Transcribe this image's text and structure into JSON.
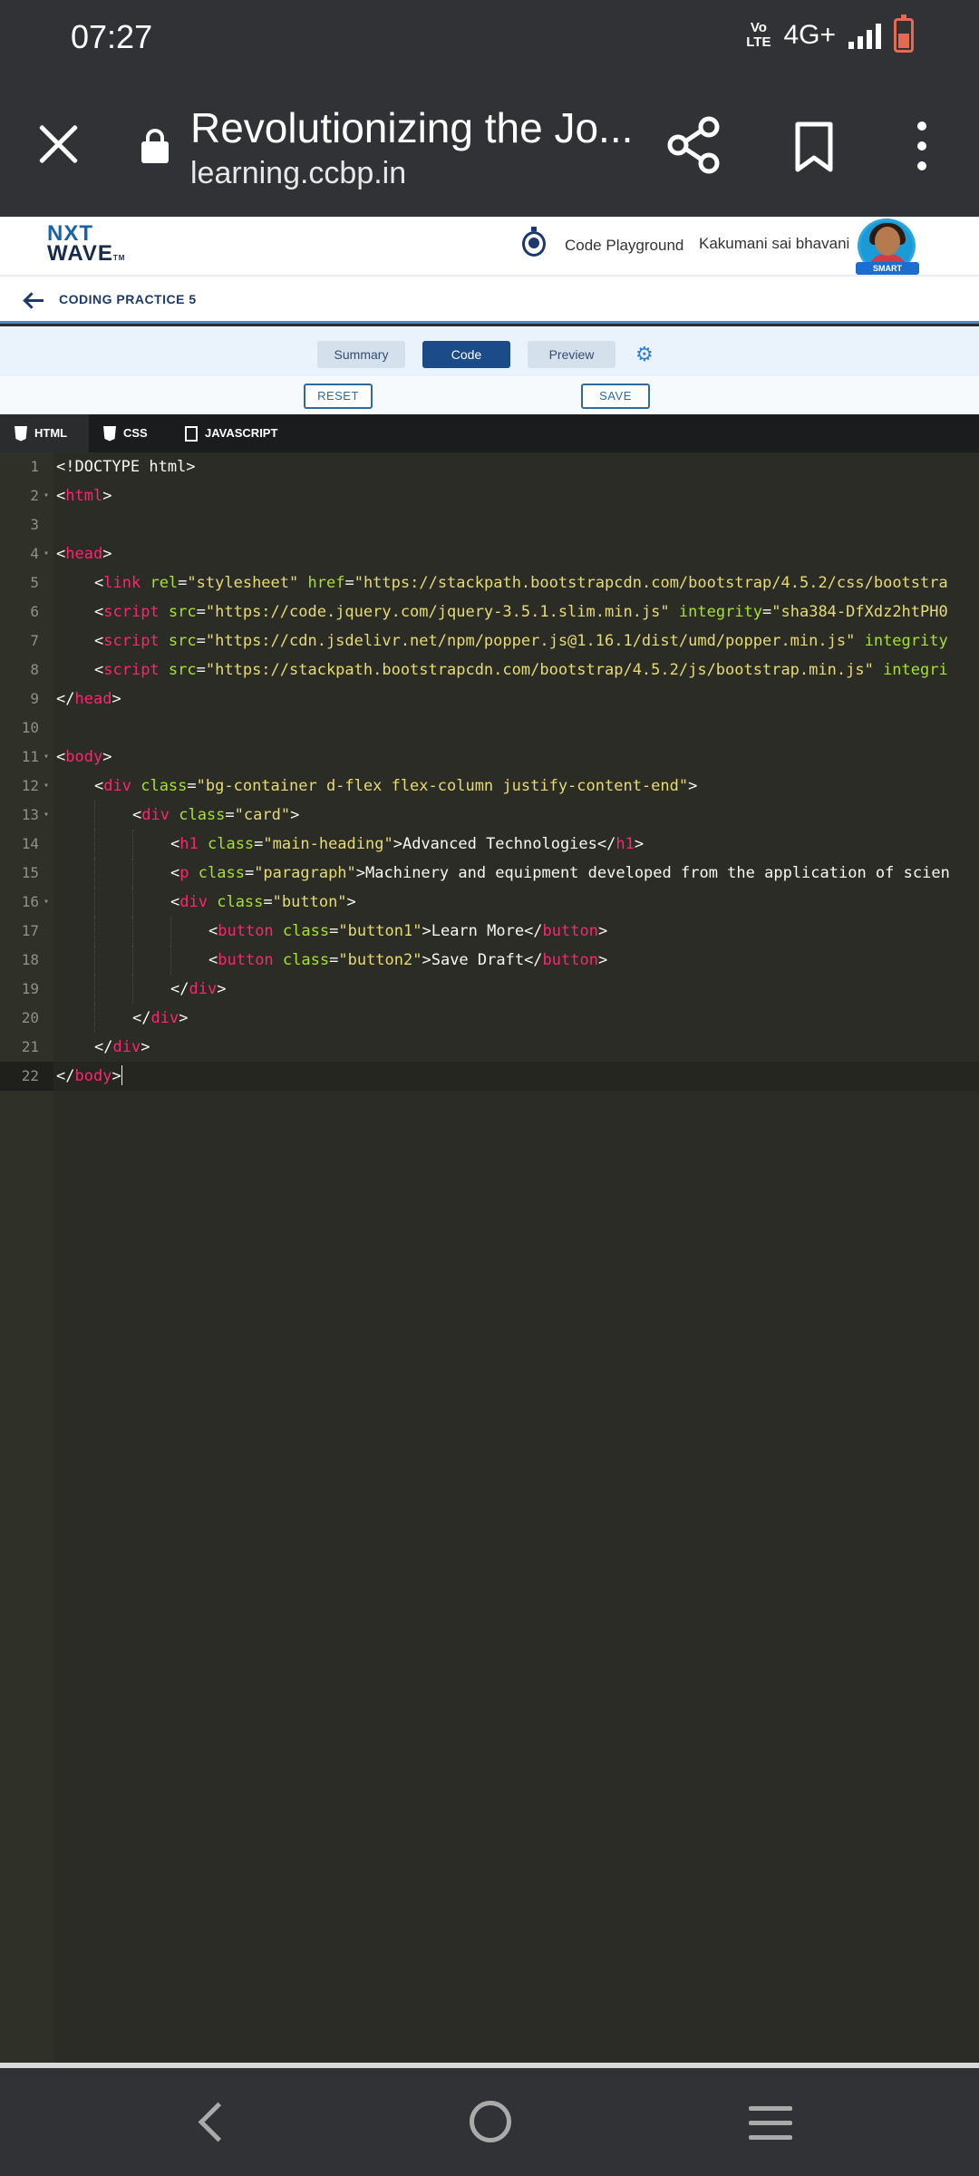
{
  "status_bar": {
    "time": "07:27",
    "volte_top": "Vo",
    "volte_bottom": "LTE",
    "network": "4G+"
  },
  "browser": {
    "title": "Revolutionizing the Jo...",
    "url": "learning.ccbp.in"
  },
  "site_header": {
    "logo_line1": "NXT",
    "logo_line2": "WAVE",
    "logo_tm": "TM",
    "playground_label": "Code Playground",
    "user_name": "Kakumani sai bhavani",
    "avatar_badge": "SMART"
  },
  "practice": {
    "title": "CODING PRACTICE 5"
  },
  "tabs": {
    "summary": "Summary",
    "code": "Code",
    "preview": "Preview"
  },
  "actions": {
    "reset": "RESET",
    "save": "SAVE"
  },
  "editor_tabs": {
    "html": "HTML",
    "css": "CSS",
    "js": "JAVASCRIPT"
  },
  "colors": {
    "tag": "#f92672",
    "attr": "#a6e22e",
    "string": "#e6db74",
    "text": "#f8f8f2",
    "accent": "#1b4b89"
  },
  "code_lines": [
    {
      "n": "1",
      "fold": false,
      "indent": 0,
      "tokens": [
        {
          "t": "<!DOCTYPE html>",
          "c": "text"
        }
      ]
    },
    {
      "n": "2",
      "fold": true,
      "indent": 0,
      "tokens": [
        {
          "t": "<",
          "c": "text"
        },
        {
          "t": "html",
          "c": "tag"
        },
        {
          "t": ">",
          "c": "text"
        }
      ]
    },
    {
      "n": "3",
      "fold": false,
      "indent": 0,
      "tokens": []
    },
    {
      "n": "4",
      "fold": true,
      "indent": 0,
      "tokens": [
        {
          "t": "<",
          "c": "text"
        },
        {
          "t": "head",
          "c": "tag"
        },
        {
          "t": ">",
          "c": "text"
        }
      ]
    },
    {
      "n": "5",
      "fold": false,
      "indent": 1,
      "tokens": [
        {
          "t": "<",
          "c": "text"
        },
        {
          "t": "link",
          "c": "tag"
        },
        {
          "t": " ",
          "c": "text"
        },
        {
          "t": "rel",
          "c": "attr"
        },
        {
          "t": "=",
          "c": "text"
        },
        {
          "t": "\"stylesheet\"",
          "c": "string"
        },
        {
          "t": " ",
          "c": "text"
        },
        {
          "t": "href",
          "c": "attr"
        },
        {
          "t": "=",
          "c": "text"
        },
        {
          "t": "\"https://stackpath.bootstrapcdn.com/bootstrap/4.5.2/css/bootstra",
          "c": "string"
        }
      ]
    },
    {
      "n": "6",
      "fold": false,
      "indent": 1,
      "tokens": [
        {
          "t": "<",
          "c": "text"
        },
        {
          "t": "script",
          "c": "tag"
        },
        {
          "t": " ",
          "c": "text"
        },
        {
          "t": "src",
          "c": "attr"
        },
        {
          "t": "=",
          "c": "text"
        },
        {
          "t": "\"https://code.jquery.com/jquery-3.5.1.slim.min.js\"",
          "c": "string"
        },
        {
          "t": " ",
          "c": "text"
        },
        {
          "t": "integrity",
          "c": "attr"
        },
        {
          "t": "=",
          "c": "text"
        },
        {
          "t": "\"sha384-DfXdz2htPH0",
          "c": "string"
        }
      ]
    },
    {
      "n": "7",
      "fold": false,
      "indent": 1,
      "tokens": [
        {
          "t": "<",
          "c": "text"
        },
        {
          "t": "script",
          "c": "tag"
        },
        {
          "t": " ",
          "c": "text"
        },
        {
          "t": "src",
          "c": "attr"
        },
        {
          "t": "=",
          "c": "text"
        },
        {
          "t": "\"https://cdn.jsdelivr.net/npm/popper.js@1.16.1/dist/umd/popper.min.js\"",
          "c": "string"
        },
        {
          "t": " ",
          "c": "text"
        },
        {
          "t": "integrity",
          "c": "attr"
        }
      ]
    },
    {
      "n": "8",
      "fold": false,
      "indent": 1,
      "tokens": [
        {
          "t": "<",
          "c": "text"
        },
        {
          "t": "script",
          "c": "tag"
        },
        {
          "t": " ",
          "c": "text"
        },
        {
          "t": "src",
          "c": "attr"
        },
        {
          "t": "=",
          "c": "text"
        },
        {
          "t": "\"https://stackpath.bootstrapcdn.com/bootstrap/4.5.2/js/bootstrap.min.js\"",
          "c": "string"
        },
        {
          "t": " ",
          "c": "text"
        },
        {
          "t": "integri",
          "c": "attr"
        }
      ]
    },
    {
      "n": "9",
      "fold": false,
      "indent": 0,
      "tokens": [
        {
          "t": "</",
          "c": "text"
        },
        {
          "t": "head",
          "c": "tag"
        },
        {
          "t": ">",
          "c": "text"
        }
      ]
    },
    {
      "n": "10",
      "fold": false,
      "indent": 0,
      "tokens": []
    },
    {
      "n": "11",
      "fold": true,
      "indent": 0,
      "tokens": [
        {
          "t": "<",
          "c": "text"
        },
        {
          "t": "body",
          "c": "tag"
        },
        {
          "t": ">",
          "c": "text"
        }
      ]
    },
    {
      "n": "12",
      "fold": true,
      "indent": 1,
      "tokens": [
        {
          "t": "<",
          "c": "text"
        },
        {
          "t": "div",
          "c": "tag"
        },
        {
          "t": " ",
          "c": "text"
        },
        {
          "t": "class",
          "c": "attr"
        },
        {
          "t": "=",
          "c": "text"
        },
        {
          "t": "\"bg-container d-flex flex-column justify-content-end\"",
          "c": "string"
        },
        {
          "t": ">",
          "c": "text"
        }
      ]
    },
    {
      "n": "13",
      "fold": true,
      "indent": 2,
      "tokens": [
        {
          "t": "<",
          "c": "text"
        },
        {
          "t": "div",
          "c": "tag"
        },
        {
          "t": " ",
          "c": "text"
        },
        {
          "t": "class",
          "c": "attr"
        },
        {
          "t": "=",
          "c": "text"
        },
        {
          "t": "\"card\"",
          "c": "string"
        },
        {
          "t": ">",
          "c": "text"
        }
      ]
    },
    {
      "n": "14",
      "fold": false,
      "indent": 3,
      "tokens": [
        {
          "t": "<",
          "c": "text"
        },
        {
          "t": "h1",
          "c": "tag"
        },
        {
          "t": " ",
          "c": "text"
        },
        {
          "t": "class",
          "c": "attr"
        },
        {
          "t": "=",
          "c": "text"
        },
        {
          "t": "\"main-heading\"",
          "c": "string"
        },
        {
          "t": ">Advanced Technologies</",
          "c": "text"
        },
        {
          "t": "h1",
          "c": "tag"
        },
        {
          "t": ">",
          "c": "text"
        }
      ]
    },
    {
      "n": "15",
      "fold": false,
      "indent": 3,
      "tokens": [
        {
          "t": "<",
          "c": "text"
        },
        {
          "t": "p",
          "c": "tag"
        },
        {
          "t": " ",
          "c": "text"
        },
        {
          "t": "class",
          "c": "attr"
        },
        {
          "t": "=",
          "c": "text"
        },
        {
          "t": "\"paragraph\"",
          "c": "string"
        },
        {
          "t": ">Machinery and equipment developed from the application of scien",
          "c": "text"
        }
      ]
    },
    {
      "n": "16",
      "fold": true,
      "indent": 3,
      "tokens": [
        {
          "t": "<",
          "c": "text"
        },
        {
          "t": "div",
          "c": "tag"
        },
        {
          "t": " ",
          "c": "text"
        },
        {
          "t": "class",
          "c": "attr"
        },
        {
          "t": "=",
          "c": "text"
        },
        {
          "t": "\"button\"",
          "c": "string"
        },
        {
          "t": ">",
          "c": "text"
        }
      ]
    },
    {
      "n": "17",
      "fold": false,
      "indent": 4,
      "tokens": [
        {
          "t": "<",
          "c": "text"
        },
        {
          "t": "button",
          "c": "tag"
        },
        {
          "t": " ",
          "c": "text"
        },
        {
          "t": "class",
          "c": "attr"
        },
        {
          "t": "=",
          "c": "text"
        },
        {
          "t": "\"button1\"",
          "c": "string"
        },
        {
          "t": ">Learn More</",
          "c": "text"
        },
        {
          "t": "button",
          "c": "tag"
        },
        {
          "t": ">",
          "c": "text"
        }
      ]
    },
    {
      "n": "18",
      "fold": false,
      "indent": 4,
      "tokens": [
        {
          "t": "<",
          "c": "text"
        },
        {
          "t": "button",
          "c": "tag"
        },
        {
          "t": " ",
          "c": "text"
        },
        {
          "t": "class",
          "c": "attr"
        },
        {
          "t": "=",
          "c": "text"
        },
        {
          "t": "\"button2\"",
          "c": "string"
        },
        {
          "t": ">Save Draft</",
          "c": "text"
        },
        {
          "t": "button",
          "c": "tag"
        },
        {
          "t": ">",
          "c": "text"
        }
      ]
    },
    {
      "n": "19",
      "fold": false,
      "indent": 3,
      "tokens": [
        {
          "t": "</",
          "c": "text"
        },
        {
          "t": "div",
          "c": "tag"
        },
        {
          "t": ">",
          "c": "text"
        }
      ]
    },
    {
      "n": "20",
      "fold": false,
      "indent": 2,
      "tokens": [
        {
          "t": "</",
          "c": "text"
        },
        {
          "t": "div",
          "c": "tag"
        },
        {
          "t": ">",
          "c": "text"
        }
      ]
    },
    {
      "n": "21",
      "fold": false,
      "indent": 1,
      "tokens": [
        {
          "t": "</",
          "c": "text"
        },
        {
          "t": "div",
          "c": "tag"
        },
        {
          "t": ">",
          "c": "text"
        }
      ]
    },
    {
      "n": "22",
      "fold": false,
      "indent": 0,
      "tokens": [
        {
          "t": "</",
          "c": "text"
        },
        {
          "t": "body",
          "c": "tag"
        },
        {
          "t": ">",
          "c": "text"
        }
      ],
      "active": true
    }
  ]
}
